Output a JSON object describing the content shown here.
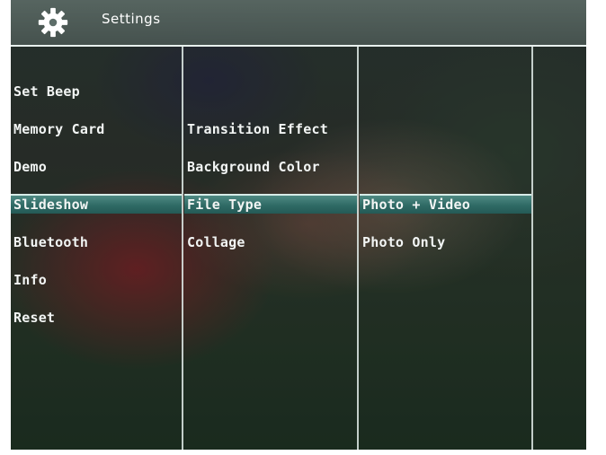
{
  "header": {
    "title": "Settings",
    "icon": "gear-icon"
  },
  "columns": [
    {
      "items": [
        "Set Beep",
        "Memory Card",
        "Demo",
        "Slideshow",
        "Bluetooth",
        "Info",
        "Reset"
      ],
      "selected": "Slideshow"
    },
    {
      "items": [
        "Transition Effect",
        "Background Color",
        "File Type",
        "Collage"
      ],
      "selected": "File Type"
    },
    {
      "items": [
        "Photo + Video",
        "Photo Only"
      ],
      "selected": "Photo + Video"
    }
  ],
  "colors": {
    "highlight": "#2f6a65",
    "text": "#f2f5f4",
    "divider": "#e8f0ee"
  }
}
